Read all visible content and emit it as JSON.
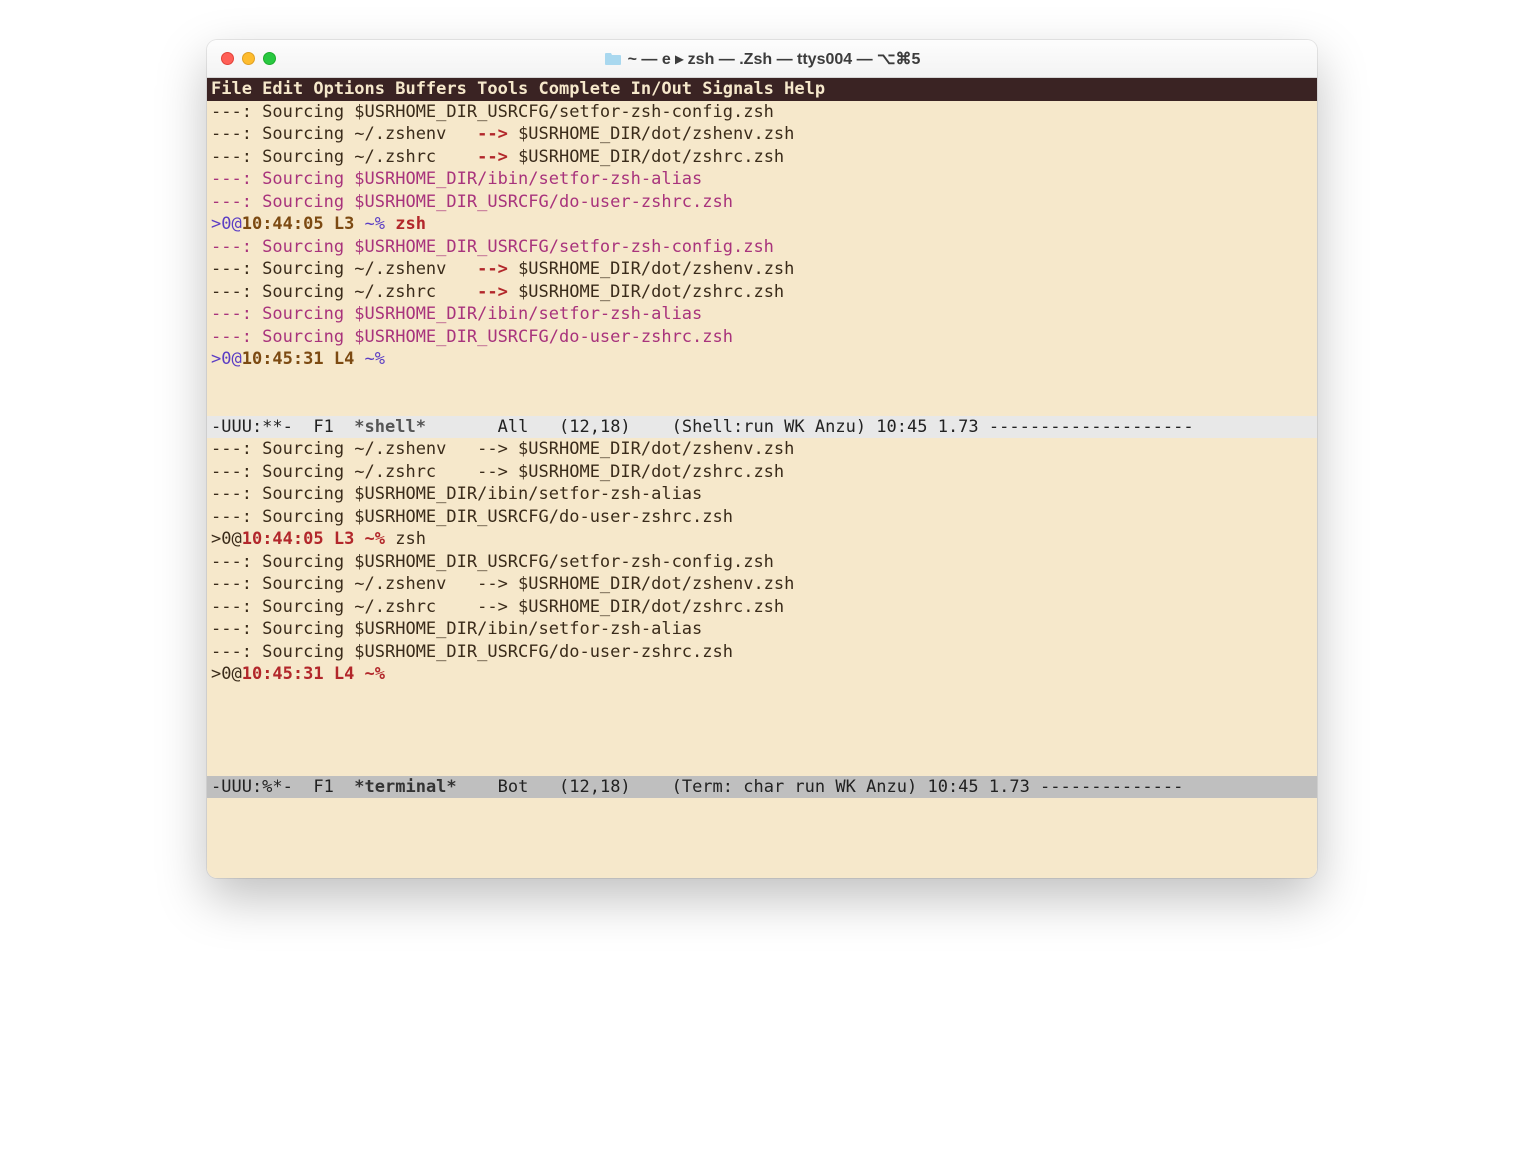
{
  "window": {
    "title": "~ — e ▸ zsh — .Zsh — ttys004 — ⌥⌘5"
  },
  "menubar": "File Edit Options Buffers Tools Complete In/Out Signals Help",
  "pane1": {
    "lines": [
      {
        "segs": [
          {
            "t": "---: Sourcing $USRHOME_DIR_USRCFG/setfor-zsh-config.zsh",
            "c": "blk"
          }
        ]
      },
      {
        "segs": [
          {
            "t": "---: Sourcing ~/.zshenv   ",
            "c": "blk"
          },
          {
            "t": "-->",
            "c": "red"
          },
          {
            "t": " $USRHOME_DIR/dot/zshenv.zsh",
            "c": "blk"
          }
        ]
      },
      {
        "segs": [
          {
            "t": "---: Sourcing ~/.zshrc    ",
            "c": "blk"
          },
          {
            "t": "-->",
            "c": "red"
          },
          {
            "t": " $USRHOME_DIR/dot/zshrc.zsh",
            "c": "blk"
          }
        ]
      },
      {
        "segs": [
          {
            "t": "---: Sourcing $USRHOME_DIR/ibin/setfor-zsh-alias",
            "c": "mag"
          }
        ]
      },
      {
        "segs": [
          {
            "t": "---: Sourcing $USRHOME_DIR_USRCFG/do-user-zshrc.zsh",
            "c": "mag"
          }
        ]
      },
      {
        "segs": [
          {
            "t": ">0@",
            "c": "pur"
          },
          {
            "t": "10:44:05 L3 ",
            "c": "brn"
          },
          {
            "t": "~% ",
            "c": "pur"
          },
          {
            "t": "zsh",
            "c": "red"
          }
        ]
      },
      {
        "segs": [
          {
            "t": "---: Sourcing $USRHOME_DIR_USRCFG/setfor-zsh-config.zsh",
            "c": "mag"
          }
        ]
      },
      {
        "segs": [
          {
            "t": "---: Sourcing ~/.zshenv   ",
            "c": "blk"
          },
          {
            "t": "-->",
            "c": "red"
          },
          {
            "t": " $USRHOME_DIR/dot/zshenv.zsh",
            "c": "blk"
          }
        ]
      },
      {
        "segs": [
          {
            "t": "---: Sourcing ~/.zshrc    ",
            "c": "blk"
          },
          {
            "t": "-->",
            "c": "red"
          },
          {
            "t": " $USRHOME_DIR/dot/zshrc.zsh",
            "c": "blk"
          }
        ]
      },
      {
        "segs": [
          {
            "t": "---: Sourcing $USRHOME_DIR/ibin/setfor-zsh-alias",
            "c": "mag"
          }
        ]
      },
      {
        "segs": [
          {
            "t": "---: Sourcing $USRHOME_DIR_USRCFG/do-user-zshrc.zsh",
            "c": "mag"
          }
        ]
      },
      {
        "segs": [
          {
            "t": ">0@",
            "c": "pur"
          },
          {
            "t": "10:45:31 L4 ",
            "c": "brn"
          },
          {
            "t": "~%",
            "c": "pur"
          }
        ]
      }
    ],
    "modeline": {
      "prefix": "-UUU:**-  F1  ",
      "buffer": "*shell*",
      "spacer": "       ",
      "pos": "All   (12,18)    (Shell:run WK Anzu) 10:45 1.73 --------------------"
    }
  },
  "pane2": {
    "lines": [
      {
        "segs": [
          {
            "t": "---: Sourcing ~/.zshenv   --> $USRHOME_DIR/dot/zshenv.zsh",
            "c": "blk"
          }
        ]
      },
      {
        "segs": [
          {
            "t": "---: Sourcing ~/.zshrc    --> $USRHOME_DIR/dot/zshrc.zsh",
            "c": "blk"
          }
        ]
      },
      {
        "segs": [
          {
            "t": "---: Sourcing $USRHOME_DIR/ibin/setfor-zsh-alias",
            "c": "blk"
          }
        ]
      },
      {
        "segs": [
          {
            "t": "---: Sourcing $USRHOME_DIR_USRCFG/do-user-zshrc.zsh",
            "c": "blk"
          }
        ]
      },
      {
        "segs": [
          {
            "t": ">0@",
            "c": "blk"
          },
          {
            "t": "10:44:05 L3 ~%",
            "c": "redn",
            "bold": true
          },
          {
            "t": " zsh",
            "c": "blk"
          }
        ]
      },
      {
        "segs": [
          {
            "t": "---: Sourcing $USRHOME_DIR_USRCFG/setfor-zsh-config.zsh",
            "c": "blk"
          }
        ]
      },
      {
        "segs": [
          {
            "t": "---: Sourcing ~/.zshenv   --> $USRHOME_DIR/dot/zshenv.zsh",
            "c": "blk"
          }
        ]
      },
      {
        "segs": [
          {
            "t": "---: Sourcing ~/.zshrc    --> $USRHOME_DIR/dot/zshrc.zsh",
            "c": "blk"
          }
        ]
      },
      {
        "segs": [
          {
            "t": "---: Sourcing $USRHOME_DIR/ibin/setfor-zsh-alias",
            "c": "blk"
          }
        ]
      },
      {
        "segs": [
          {
            "t": "---: Sourcing $USRHOME_DIR_USRCFG/do-user-zshrc.zsh",
            "c": "blk"
          }
        ]
      },
      {
        "segs": [
          {
            "t": ">0@",
            "c": "blk"
          },
          {
            "t": "10:45:31 L4 ~%",
            "c": "redn",
            "bold": true
          }
        ]
      }
    ],
    "modeline": {
      "prefix": "-UUU:%*-  F1  ",
      "buffer": "*terminal*",
      "spacer": "    ",
      "pos": "Bot   (12,18)    (Term: char run WK Anzu) 10:45 1.73 --------------"
    }
  }
}
